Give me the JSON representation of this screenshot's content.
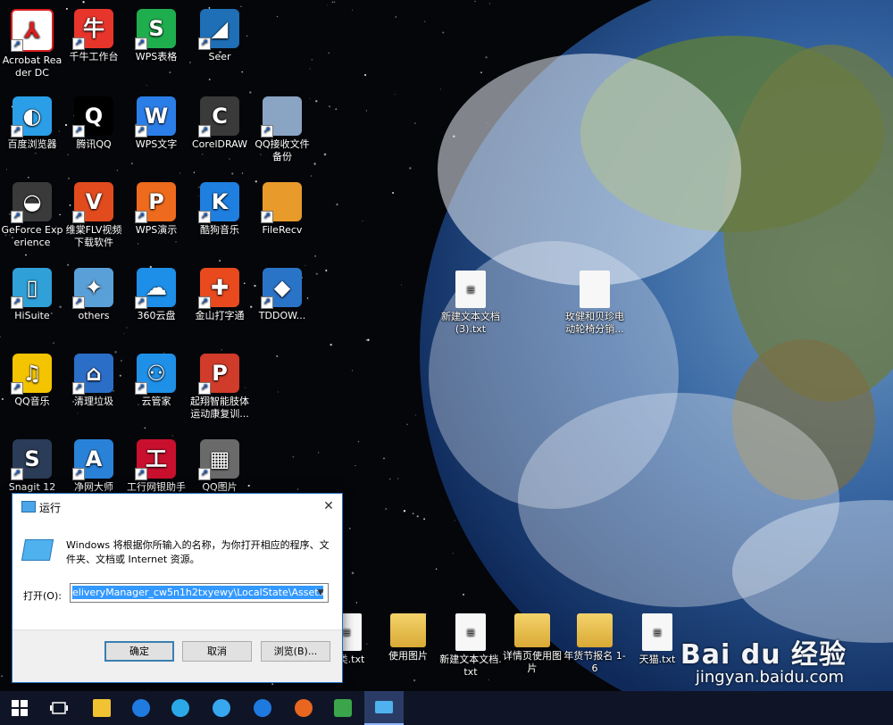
{
  "desktop": {
    "icons": [
      {
        "label": "Acrobat Reader DC",
        "icon": "acrobat-icon",
        "color": "#ffffff"
      },
      {
        "label": "千牛工作台",
        "icon": "qianniu-icon",
        "color": "#e8352b"
      },
      {
        "label": "WPS表格",
        "icon": "wps-spreadsheet-icon",
        "color": "#1fae4e"
      },
      {
        "label": "Seer",
        "icon": "seer-icon",
        "color": "#1e6fb5"
      },
      {
        "label": "百度浏览器",
        "icon": "baidu-browser-icon",
        "color": "#2a9fe8"
      },
      {
        "label": "腾讯QQ",
        "icon": "qq-icon",
        "color": "#000000"
      },
      {
        "label": "WPS文字",
        "icon": "wps-writer-icon",
        "color": "#2b7ee8"
      },
      {
        "label": "CorelDRAW",
        "icon": "coreldraw-icon",
        "color": "#3a3a3a"
      },
      {
        "label": "QQ接收文件备份",
        "icon": "folder-icon",
        "color": "#8aa4c4"
      },
      {
        "label": "GeForce Experience",
        "icon": "geforce-icon",
        "color": "#3a3a3a"
      },
      {
        "label": "维棠FLV视频下载软件",
        "icon": "flv-download-icon",
        "color": "#e24b1e"
      },
      {
        "label": "WPS演示",
        "icon": "wps-presentation-icon",
        "color": "#ee6a1c"
      },
      {
        "label": "酷狗音乐",
        "icon": "kugou-icon",
        "color": "#1e7fe0"
      },
      {
        "label": "FileRecv",
        "icon": "folder-icon",
        "color": "#e89a2b"
      },
      {
        "label": "HiSuite",
        "icon": "hisuite-icon",
        "color": "#2fa0d8"
      },
      {
        "label": "others",
        "icon": "others-icon",
        "color": "#5aa0d8"
      },
      {
        "label": "360云盘",
        "icon": "cloud-360-icon",
        "color": "#1d8fe8"
      },
      {
        "label": "金山打字通",
        "icon": "jinshan-typing-icon",
        "color": "#e84a1e"
      },
      {
        "label": "TDDOW...",
        "icon": "dropbox-icon",
        "color": "#2a74c8"
      },
      {
        "label": "QQ音乐",
        "icon": "qq-music-icon",
        "color": "#f5c400"
      },
      {
        "label": "清理垃圾",
        "icon": "broom-icon",
        "color": "#2b6ec8"
      },
      {
        "label": "云管家",
        "icon": "cloud-manager-icon",
        "color": "#1f90e8"
      },
      {
        "label": "起翔智能肢体运动康复训...",
        "icon": "ppt-file-icon",
        "color": "#d03b2a"
      },
      {
        "label": "Snagit 12",
        "icon": "snagit-icon",
        "color": "#2b3c58"
      },
      {
        "label": "净网大师",
        "icon": "jingwang-icon",
        "color": "#2a82d8"
      },
      {
        "label": "工行网银助手",
        "icon": "icbc-icon",
        "color": "#c8102e"
      },
      {
        "label": "QQ图片",
        "icon": "image-icon",
        "color": "#6a6a6a"
      }
    ],
    "files": [
      {
        "label": "新建文本文档 (3).txt",
        "icon": "text-file-icon"
      },
      {
        "label": "玫健和贝珍电动轮椅分销...",
        "icon": "excel-zip-icon"
      },
      {
        "label": "器类.txt",
        "icon": "text-file-icon"
      },
      {
        "label": "使用图片",
        "icon": "folder-icon"
      },
      {
        "label": "新建文本文档.txt",
        "icon": "text-file-icon"
      },
      {
        "label": "详情页使用图片",
        "icon": "folder-icon"
      },
      {
        "label": "年货节报名 1-6",
        "icon": "folder-icon"
      },
      {
        "label": "天猫.txt",
        "icon": "text-file-icon"
      }
    ]
  },
  "run_dialog": {
    "title": "运行",
    "close": "✕",
    "description": "Windows 将根据你所输入的名称，为你打开相应的程序、文件夹、文档或 Internet 资源。",
    "open_label": "打开(O):",
    "input_value": "eliveryManager_cw5n1h2txyewy\\LocalState\\Assets",
    "ok": "确定",
    "cancel": "取消",
    "browse": "浏览(B)..."
  },
  "taskbar": {
    "icons": [
      "windows-start-icon",
      "task-view-icon",
      "file-explorer-icon",
      "edge-icon",
      "ie-icon",
      "baidu-browser-icon",
      "kugou-icon",
      "firefox-icon",
      "photo-app-icon",
      "run-icon"
    ]
  },
  "watermark": {
    "brand": "Bai du 经验",
    "url": "jingyan.baidu.com"
  }
}
